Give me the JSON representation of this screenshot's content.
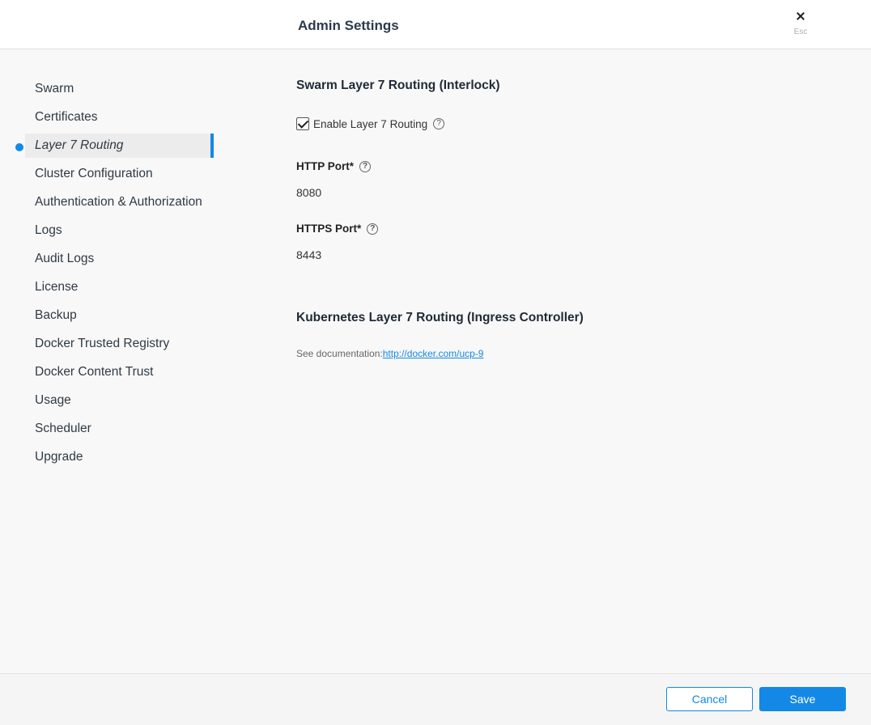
{
  "header": {
    "title": "Admin Settings",
    "close_icon": "close-icon",
    "esc_label": "Esc"
  },
  "sidebar": {
    "active_index": 2,
    "accent_color": "#1488e6",
    "items": [
      {
        "label": "Swarm"
      },
      {
        "label": "Certificates"
      },
      {
        "label": "Layer 7 Routing"
      },
      {
        "label": "Cluster Configuration"
      },
      {
        "label": "Authentication & Authorization"
      },
      {
        "label": "Logs"
      },
      {
        "label": "Audit Logs"
      },
      {
        "label": "License"
      },
      {
        "label": "Backup"
      },
      {
        "label": "Docker Trusted Registry"
      },
      {
        "label": "Docker Content Trust"
      },
      {
        "label": "Usage"
      },
      {
        "label": "Scheduler"
      },
      {
        "label": "Upgrade"
      }
    ]
  },
  "main": {
    "swarm_section": {
      "title": "Swarm Layer 7 Routing (Interlock)",
      "enable_checkbox": {
        "label": "Enable Layer 7 Routing",
        "checked": true
      },
      "http_port": {
        "label": "HTTP Port*",
        "value": "8080"
      },
      "https_port": {
        "label": "HTTPS Port*",
        "value": "8443"
      },
      "help_icon": "question-circle-icon"
    },
    "kubernetes_section": {
      "title": "Kubernetes Layer 7 Routing (Ingress Controller)",
      "doc_prefix": "See documentation:",
      "doc_link": "http://docker.com/ucp-9"
    }
  },
  "footer": {
    "cancel_label": "Cancel",
    "save_label": "Save"
  }
}
